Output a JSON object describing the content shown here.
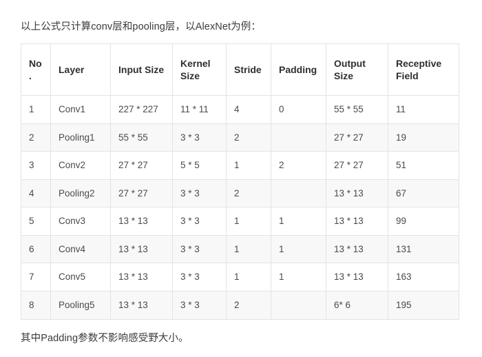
{
  "document": {
    "intro_text": "以上公式只计算conv层和pooling层，以AlexNet为例：",
    "note_text": "其中Padding参数不影响感受野大小。"
  },
  "colors": {
    "text": "#333333",
    "table_border": "#e3e3e3",
    "row_alt_background": "#f8f8f8",
    "row_background": "#ffffff",
    "header_text": "#2f2f2f"
  },
  "table": {
    "headers": [
      "No.",
      "Layer",
      "Input Size",
      "Kernel Size",
      "Stride",
      "Padding",
      "Output Size",
      "Receptive Field"
    ],
    "rows": [
      {
        "no": "1",
        "layer": "Conv1",
        "input_size": "227 * 227",
        "kernel_size": "11 * 11",
        "stride": "4",
        "padding": "0",
        "output_size": "55 * 55",
        "receptive_field": "11"
      },
      {
        "no": "2",
        "layer": "Pooling1",
        "input_size": "55 * 55",
        "kernel_size": "3 * 3",
        "stride": "2",
        "padding": "",
        "output_size": "27 * 27",
        "receptive_field": "19"
      },
      {
        "no": "3",
        "layer": "Conv2",
        "input_size": "27 * 27",
        "kernel_size": "5 * 5",
        "stride": "1",
        "padding": "2",
        "output_size": "27 * 27",
        "receptive_field": "51"
      },
      {
        "no": "4",
        "layer": "Pooling2",
        "input_size": "27 * 27",
        "kernel_size": "3 * 3",
        "stride": "2",
        "padding": "",
        "output_size": "13 * 13",
        "receptive_field": "67"
      },
      {
        "no": "5",
        "layer": "Conv3",
        "input_size": "13 * 13",
        "kernel_size": "3 * 3",
        "stride": "1",
        "padding": "1",
        "output_size": "13 * 13",
        "receptive_field": "99"
      },
      {
        "no": "6",
        "layer": "Conv4",
        "input_size": "13 * 13",
        "kernel_size": "3 * 3",
        "stride": "1",
        "padding": "1",
        "output_size": "13 * 13",
        "receptive_field": "131"
      },
      {
        "no": "7",
        "layer": "Conv5",
        "input_size": "13 * 13",
        "kernel_size": "3 * 3",
        "stride": "1",
        "padding": "1",
        "output_size": "13 * 13",
        "receptive_field": "163"
      },
      {
        "no": "8",
        "layer": "Pooling5",
        "input_size": "13 * 13",
        "kernel_size": "3 * 3",
        "stride": "2",
        "padding": "",
        "output_size": "6* 6",
        "receptive_field": "195"
      }
    ]
  }
}
